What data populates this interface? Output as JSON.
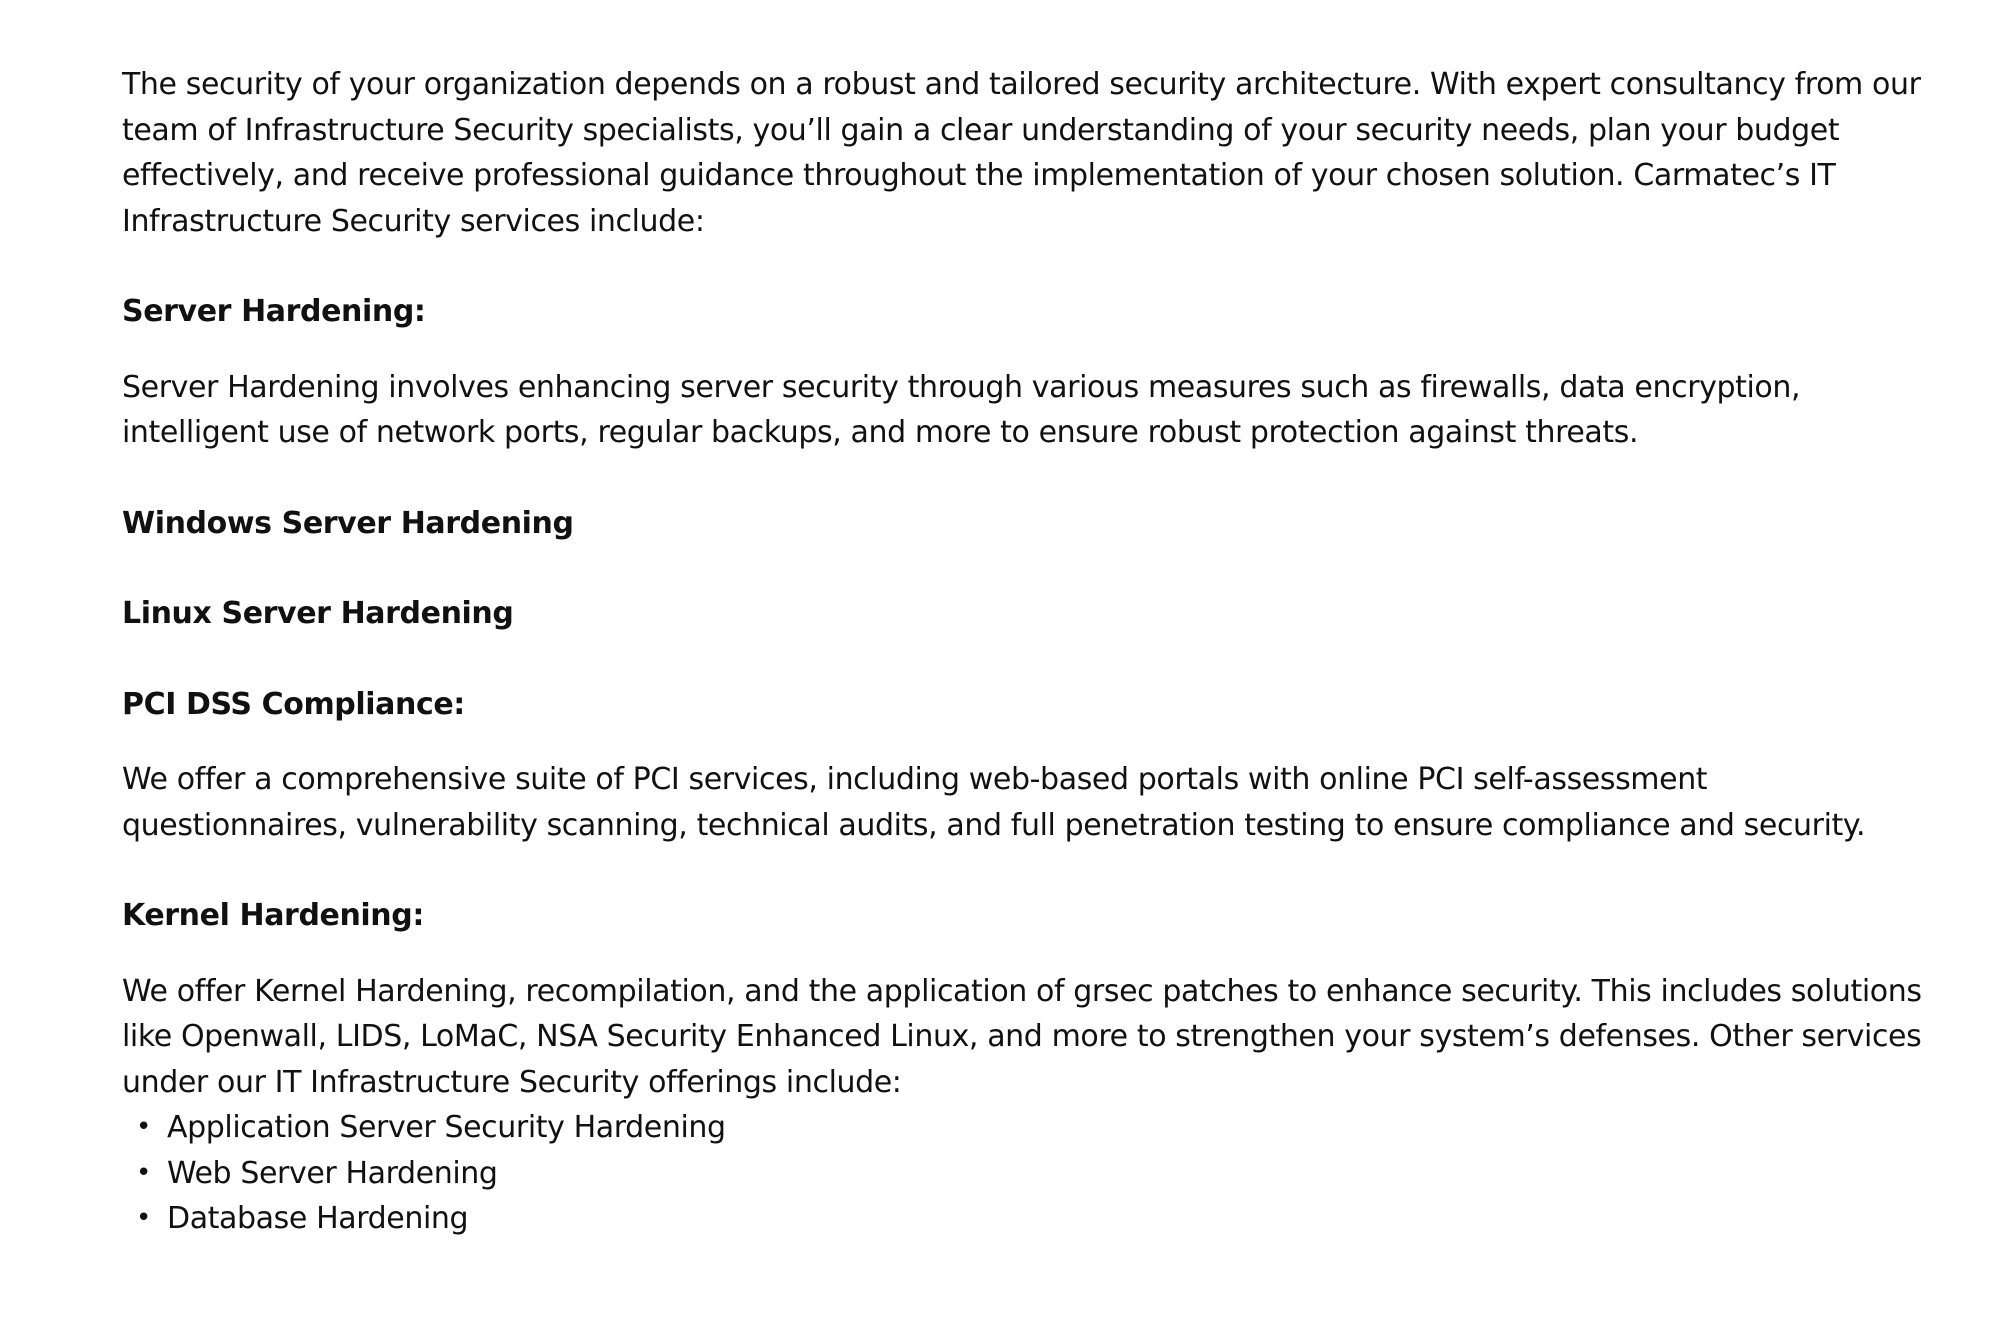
{
  "intro": "The security of your organization depends on a robust and tailored security architecture. With expert consultancy from our team of Infrastructure Security specialists, you’ll gain a clear understanding of your security needs, plan your budget effectively, and receive professional guidance throughout the implementation of your chosen solution. Carmatec’s IT Infrastructure Security services include:",
  "sections": [
    {
      "heading": "Server Hardening:",
      "body": "Server Hardening involves enhancing server security through various measures such as firewalls, data encryption, intelligent use of network ports, regular backups, and more to ensure robust protection against threats."
    },
    {
      "heading": "Windows Server Hardening"
    },
    {
      "heading": "Linux Server Hardening"
    },
    {
      "heading": "PCI DSS Compliance:",
      "body": "We offer a comprehensive suite of PCI services, including web-based portals with online PCI self-assessment questionnaires, vulnerability scanning, technical audits, and full penetration testing to ensure compliance and security."
    },
    {
      "heading": "Kernel Hardening:",
      "body": "We offer Kernel Hardening, recompilation, and the application of grsec patches to enhance security. This includes solutions like Openwall, LIDS, LoMaC, NSA Security Enhanced Linux, and more to strengthen your system’s defenses. Other services under our IT Infrastructure Security offerings include:"
    }
  ],
  "other_services": [
    "Application Server Security Hardening",
    "Web Server Hardening",
    "Database Hardening"
  ],
  "bullet_glyph": "•"
}
